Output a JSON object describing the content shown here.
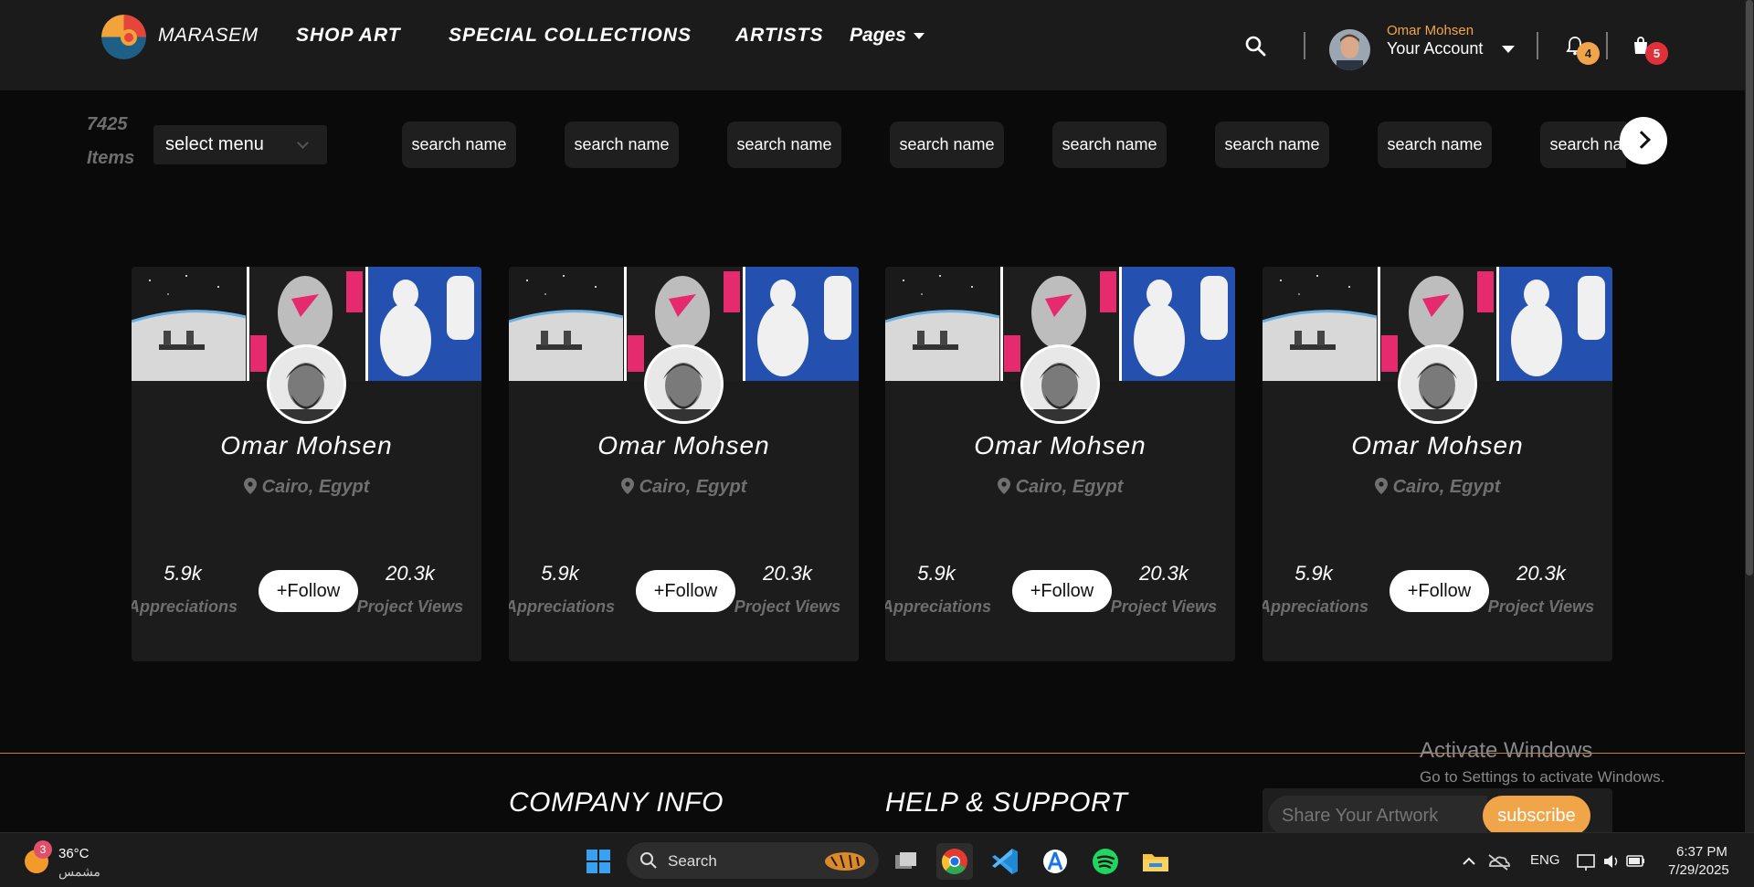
{
  "header": {
    "brand": "MARASEM",
    "nav": [
      "SHOP ART",
      "SPECIAL COLLECTIONS",
      "ARTISTS"
    ],
    "pages_label": "Pages",
    "account": {
      "name": "Omar Mohsen",
      "label": "Your Account"
    },
    "notifications_count": "4",
    "cart_count": "5"
  },
  "filters": {
    "items_count": "7425",
    "items_label": "Items",
    "select_menu": "select menu",
    "chips": [
      "search name",
      "search name",
      "search name",
      "search name",
      "search name",
      "search name",
      "search name",
      "search name"
    ]
  },
  "artists": [
    {
      "name": "Omar Mohsen",
      "location": "Cairo, Egypt",
      "appreciations": "5.9k",
      "appreciations_label": "Appreciations",
      "views": "20.3k",
      "views_label": "Project Views",
      "follow_label": "+Follow"
    },
    {
      "name": "Omar Mohsen",
      "location": "Cairo, Egypt",
      "appreciations": "5.9k",
      "appreciations_label": "Appreciations",
      "views": "20.3k",
      "views_label": "Project Views",
      "follow_label": "+Follow"
    },
    {
      "name": "Omar Mohsen",
      "location": "Cairo, Egypt",
      "appreciations": "5.9k",
      "appreciations_label": "Appreciations",
      "views": "20.3k",
      "views_label": "Project Views",
      "follow_label": "+Follow"
    },
    {
      "name": "Omar Mohsen",
      "location": "Cairo, Egypt",
      "appreciations": "5.9k",
      "appreciations_label": "Appreciations",
      "views": "20.3k",
      "views_label": "Project Views",
      "follow_label": "+Follow"
    }
  ],
  "footer": {
    "company_info": "COMPANY INFO",
    "help_support": "HELP & SUPPORT",
    "newsletter_placeholder": "Share Your Artwork",
    "subscribe_label": "subscribe"
  },
  "watermark": {
    "title": "Activate Windows",
    "subtitle": "Go to Settings to activate Windows."
  },
  "taskbar": {
    "weather_badge": "3",
    "temperature": "36°C",
    "condition": "مشمس",
    "search_label": "Search",
    "language": "ENG",
    "time": "6:37 PM",
    "date": "7/29/2025"
  },
  "colors": {
    "accent": "#f0a548",
    "cart_badge": "#e0303a",
    "header_bg": "#1b1b1b",
    "card_bg": "#1c1c1c"
  }
}
